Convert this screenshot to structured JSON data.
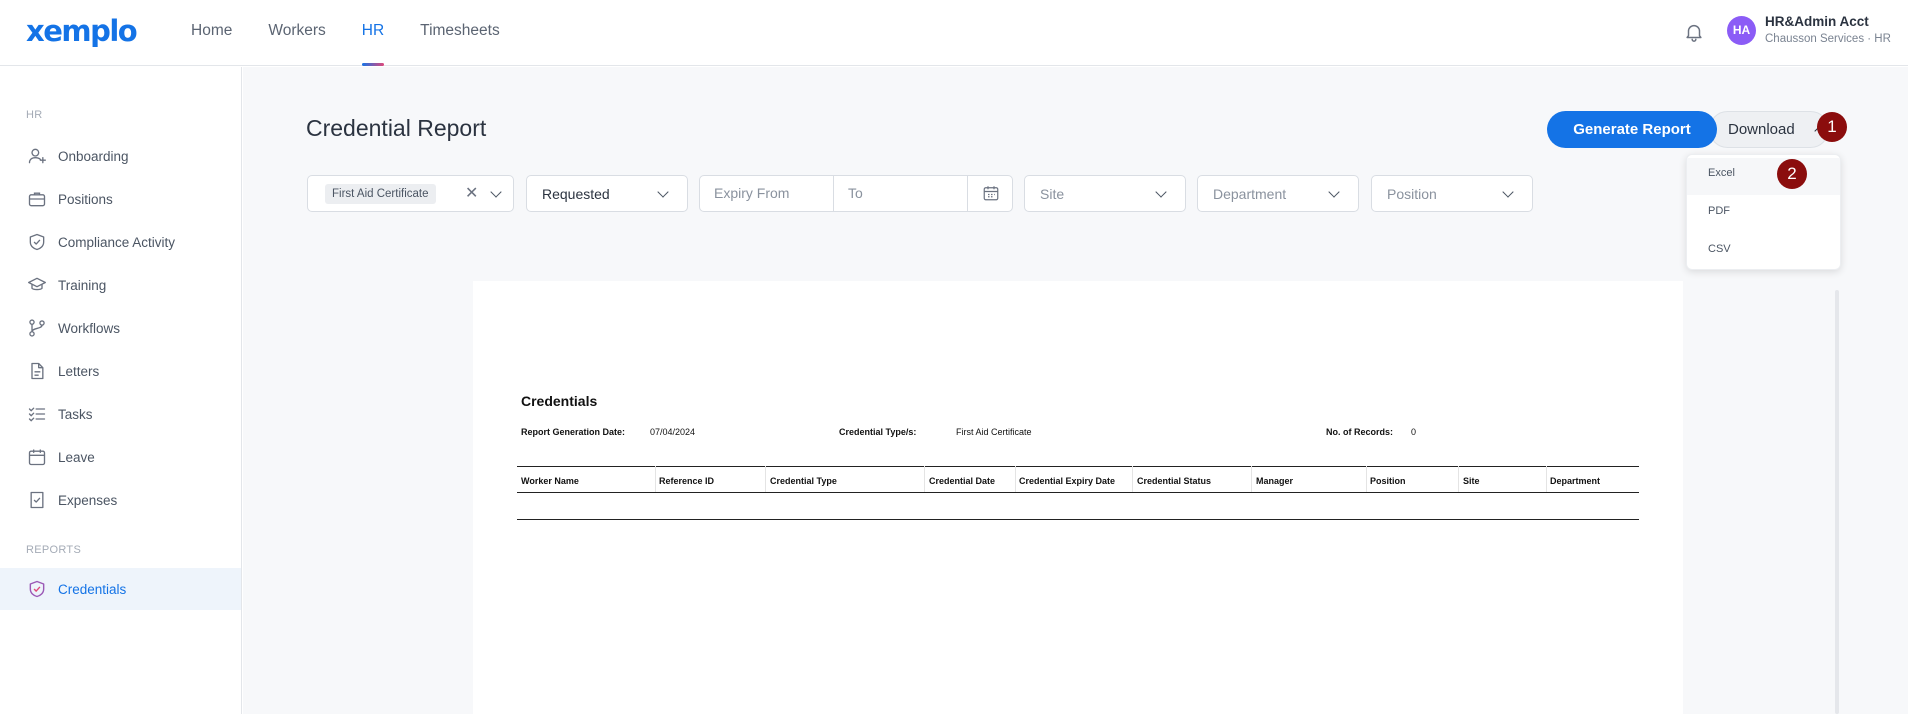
{
  "app": {
    "logo_text": "xemplo",
    "brand_color": "#1473e6"
  },
  "topnav": {
    "items": [
      {
        "label": "Home"
      },
      {
        "label": "Workers"
      },
      {
        "label": "HR",
        "active": true
      },
      {
        "label": "Timesheets"
      }
    ]
  },
  "user": {
    "initials": "HA",
    "name": "HR&Admin Acct",
    "org": "Chausson Services · HR",
    "avatar_color": "#8b5cf6"
  },
  "sidebar": {
    "section_hr": "HR",
    "items": [
      {
        "label": "Onboarding",
        "icon": "user-plus-icon"
      },
      {
        "label": "Positions",
        "icon": "briefcase-icon"
      },
      {
        "label": "Compliance Activity",
        "icon": "shield-check-icon"
      },
      {
        "label": "Training",
        "icon": "graduation-cap-icon"
      },
      {
        "label": "Workflows",
        "icon": "git-branch-icon"
      },
      {
        "label": "Letters",
        "icon": "document-icon"
      },
      {
        "label": "Tasks",
        "icon": "checklist-icon"
      },
      {
        "label": "Leave",
        "icon": "calendar-icon"
      },
      {
        "label": "Expenses",
        "icon": "receipt-check-icon"
      }
    ],
    "section_reports": "REPORTS",
    "reports": [
      {
        "label": "Credentials",
        "icon": "shield-check-icon",
        "active": true
      }
    ]
  },
  "page": {
    "title": "Credential Report",
    "generate_label": "Generate Report",
    "download_label": "Download",
    "step_badges": [
      "1",
      "2"
    ],
    "download_menu": [
      "Excel",
      "PDF",
      "CSV"
    ]
  },
  "filters": {
    "credential_chip": "First Aid Certificate",
    "status_value": "Requested",
    "expiry_from_placeholder": "Expiry From",
    "to_placeholder": "To",
    "site_placeholder": "Site",
    "department_placeholder": "Department",
    "position_placeholder": "Position"
  },
  "report": {
    "title": "Credentials",
    "generation_date_label": "Report Generation Date:",
    "generation_date": "07/04/2024",
    "credential_types_label": "Credential Type/s:",
    "credential_types": "First Aid Certificate",
    "records_label": "No. of Records:",
    "records": "0",
    "columns": [
      "Worker Name",
      "Reference ID",
      "Credential Type",
      "Credential Date",
      "Credential Expiry Date",
      "Credential Status",
      "Manager",
      "Position",
      "Site",
      "Department"
    ]
  }
}
